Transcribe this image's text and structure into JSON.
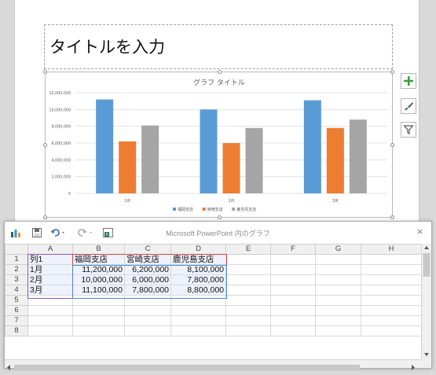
{
  "slide": {
    "title_placeholder": "タイトルを入力"
  },
  "chart_data": {
    "type": "bar",
    "title": "グラフ タイトル",
    "categories": [
      "1月",
      "2月",
      "3月"
    ],
    "series": [
      {
        "name": "福岡支店",
        "color": "#5b9bd5",
        "values": [
          11200000,
          10000000,
          11100000
        ]
      },
      {
        "name": "宮崎支店",
        "color": "#ed7d31",
        "values": [
          6200000,
          6000000,
          7800000
        ]
      },
      {
        "name": "鹿児島支店",
        "color": "#a5a5a5",
        "values": [
          8100000,
          7800000,
          8800000
        ]
      }
    ],
    "yticks": [
      "12,000,000",
      "10,000,000",
      "8,000,000",
      "6,000,000",
      "4,000,000",
      "2,000,000",
      "0"
    ],
    "ylim": [
      0,
      12000000
    ],
    "grid": true,
    "legend": "bottom"
  },
  "side_buttons": {
    "add_icon": "plus-icon",
    "style_icon": "brush-icon",
    "filter_icon": "filter-icon"
  },
  "datasheet": {
    "window_title": "Microsoft PowerPoint 内のグラフ",
    "close_label": "×",
    "columns": [
      "A",
      "B",
      "C",
      "D",
      "E",
      "F",
      "G",
      "H"
    ],
    "rows": [
      {
        "num": "1",
        "cells": [
          "列1",
          "福岡支店",
          "宮崎支店",
          "鹿児島支店",
          "",
          "",
          "",
          ""
        ]
      },
      {
        "num": "2",
        "cells": [
          "1月",
          "11,200,000",
          "6,200,000",
          "8,100,000",
          "",
          "",
          "",
          ""
        ]
      },
      {
        "num": "3",
        "cells": [
          "2月",
          "10,000,000",
          "6,000,000",
          "7,800,000",
          "",
          "",
          "",
          ""
        ]
      },
      {
        "num": "4",
        "cells": [
          "3月",
          "11,100,000",
          "7,800,000",
          "8,800,000",
          "",
          "",
          "",
          ""
        ]
      },
      {
        "num": "5",
        "cells": [
          "",
          "",
          "",
          "",
          "",
          "",
          "",
          ""
        ]
      },
      {
        "num": "6",
        "cells": [
          "",
          "",
          "",
          "",
          "",
          "",
          "",
          ""
        ]
      },
      {
        "num": "7",
        "cells": [
          "",
          "",
          "",
          "",
          "",
          "",
          "",
          ""
        ]
      },
      {
        "num": "8",
        "cells": [
          "",
          "",
          "",
          "",
          "",
          "",
          "",
          ""
        ]
      }
    ]
  }
}
